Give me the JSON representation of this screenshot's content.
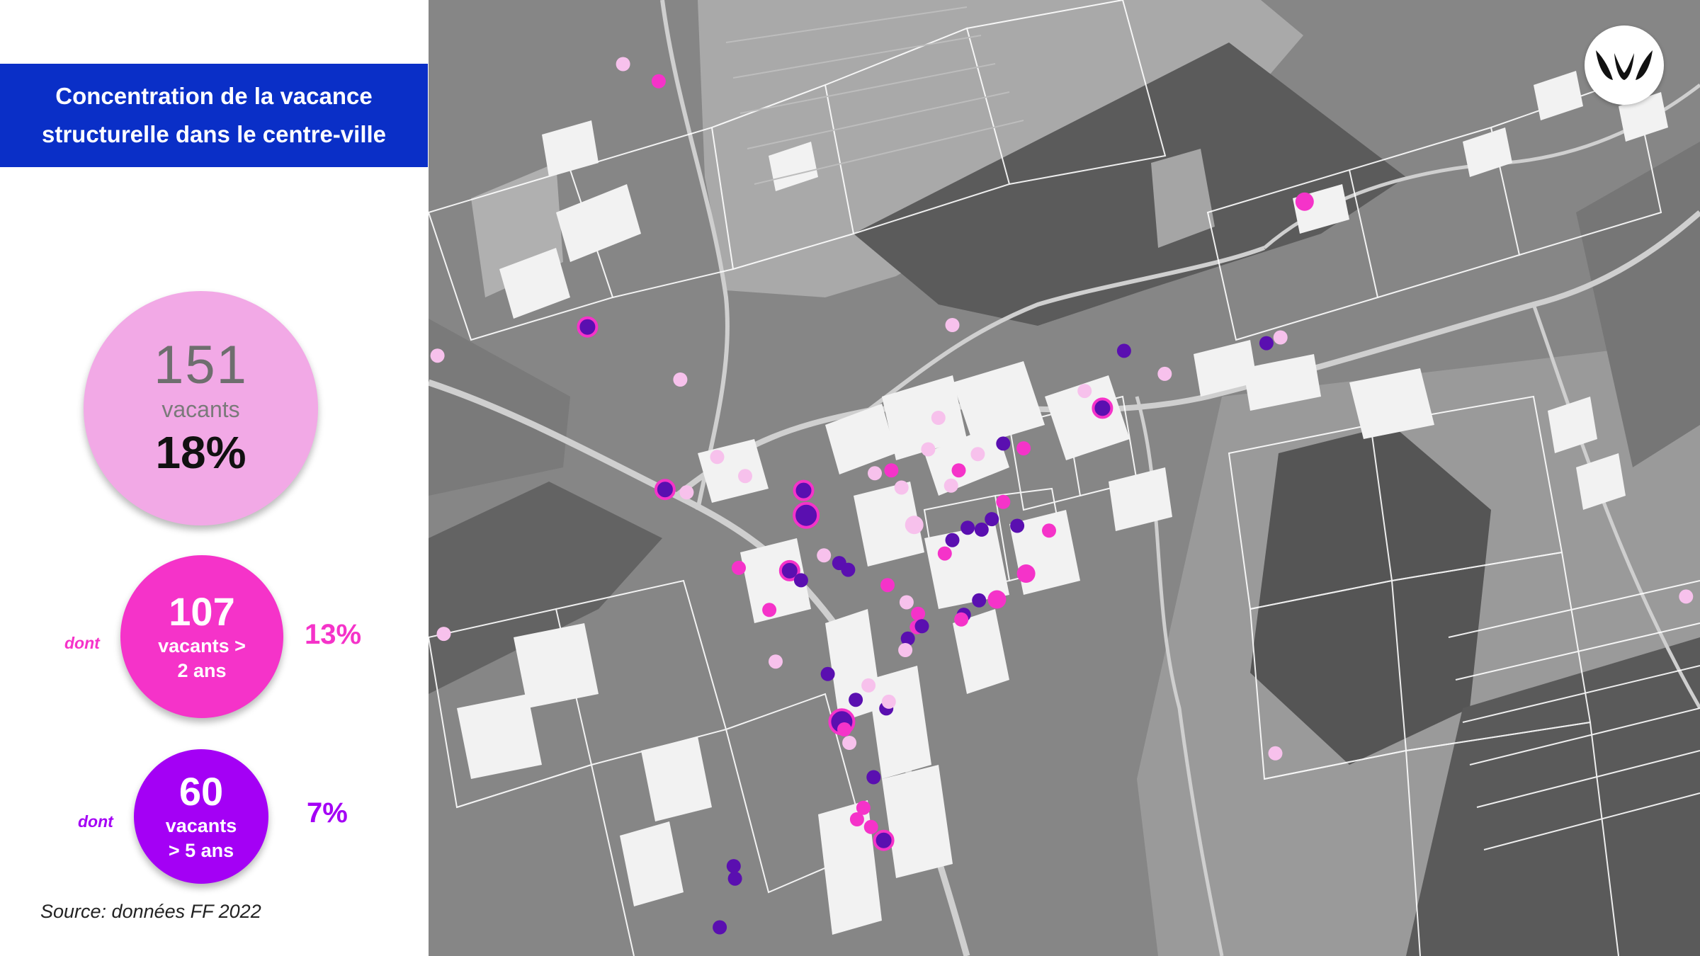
{
  "title": {
    "line1": "Concentration de la vacance",
    "line2": "structurelle dans le centre-ville"
  },
  "stats": {
    "total": {
      "count": "151",
      "label": "vacants",
      "percent": "18%",
      "color": "#f2a9e6"
    },
    "over_2_years": {
      "prefix": "dont",
      "count": "107",
      "label_line1": "vacants >",
      "label_line2": "2 ans",
      "percent": "13%",
      "color": "#f533c9"
    },
    "over_5_years": {
      "prefix": "dont",
      "count": "60",
      "label_line1": "vacants",
      "label_line2": "> 5 ans",
      "percent": "7%",
      "color": "#a400f5"
    }
  },
  "source": "Source: données FF 2022",
  "map": {
    "style": "grayscale aerial photo with white cadastral parcel outlines and highlighted buildings",
    "marker_colors": {
      "total": "#f7c1ec",
      "over_2_years": "#f533c9",
      "over_5_years": "#5a0fb0"
    },
    "markers": [
      {
        "x": 0.153,
        "y": 0.067,
        "cat": "total",
        "size": "s"
      },
      {
        "x": 0.181,
        "y": 0.085,
        "cat": "over_2_years",
        "size": "s"
      },
      {
        "x": 0.125,
        "y": 0.342,
        "cat": "over_5_years",
        "size": "m"
      },
      {
        "x": 0.007,
        "y": 0.372,
        "cat": "total",
        "size": "s"
      },
      {
        "x": 0.198,
        "y": 0.397,
        "cat": "total",
        "size": "s"
      },
      {
        "x": 0.227,
        "y": 0.478,
        "cat": "total",
        "size": "s"
      },
      {
        "x": 0.186,
        "y": 0.512,
        "cat": "over_5_years",
        "size": "m"
      },
      {
        "x": 0.203,
        "y": 0.515,
        "cat": "total",
        "size": "s"
      },
      {
        "x": 0.295,
        "y": 0.513,
        "cat": "over_5_years",
        "size": "m"
      },
      {
        "x": 0.297,
        "y": 0.539,
        "cat": "over_5_years",
        "size": "l"
      },
      {
        "x": 0.244,
        "y": 0.594,
        "cat": "over_2_years",
        "size": "s"
      },
      {
        "x": 0.284,
        "y": 0.597,
        "cat": "over_5_years",
        "size": "m"
      },
      {
        "x": 0.293,
        "y": 0.607,
        "cat": "over_5_years",
        "size": "s"
      },
      {
        "x": 0.311,
        "y": 0.581,
        "cat": "total",
        "size": "s"
      },
      {
        "x": 0.323,
        "y": 0.589,
        "cat": "over_5_years",
        "size": "s"
      },
      {
        "x": 0.33,
        "y": 0.596,
        "cat": "over_5_years",
        "size": "s"
      },
      {
        "x": 0.351,
        "y": 0.495,
        "cat": "total",
        "size": "s"
      },
      {
        "x": 0.364,
        "y": 0.492,
        "cat": "over_2_years",
        "size": "s"
      },
      {
        "x": 0.361,
        "y": 0.612,
        "cat": "over_2_years",
        "size": "s"
      },
      {
        "x": 0.382,
        "y": 0.549,
        "cat": "total",
        "size": "m"
      },
      {
        "x": 0.372,
        "y": 0.51,
        "cat": "total",
        "size": "s"
      },
      {
        "x": 0.393,
        "y": 0.47,
        "cat": "total",
        "size": "s"
      },
      {
        "x": 0.417,
        "y": 0.492,
        "cat": "over_2_years",
        "size": "s"
      },
      {
        "x": 0.411,
        "y": 0.508,
        "cat": "total",
        "size": "s"
      },
      {
        "x": 0.401,
        "y": 0.437,
        "cat": "total",
        "size": "s"
      },
      {
        "x": 0.406,
        "y": 0.579,
        "cat": "over_2_years",
        "size": "s"
      },
      {
        "x": 0.412,
        "y": 0.565,
        "cat": "over_5_years",
        "size": "s"
      },
      {
        "x": 0.424,
        "y": 0.552,
        "cat": "over_5_years",
        "size": "s"
      },
      {
        "x": 0.435,
        "y": 0.554,
        "cat": "over_5_years",
        "size": "s"
      },
      {
        "x": 0.443,
        "y": 0.543,
        "cat": "over_5_years",
        "size": "s"
      },
      {
        "x": 0.452,
        "y": 0.525,
        "cat": "over_2_years",
        "size": "s"
      },
      {
        "x": 0.463,
        "y": 0.55,
        "cat": "over_5_years",
        "size": "s"
      },
      {
        "x": 0.47,
        "y": 0.6,
        "cat": "over_2_years",
        "size": "m"
      },
      {
        "x": 0.452,
        "y": 0.464,
        "cat": "over_5_years",
        "size": "s"
      },
      {
        "x": 0.468,
        "y": 0.469,
        "cat": "over_2_years",
        "size": "s"
      },
      {
        "x": 0.432,
        "y": 0.475,
        "cat": "total",
        "size": "s"
      },
      {
        "x": 0.433,
        "y": 0.628,
        "cat": "over_5_years",
        "size": "s"
      },
      {
        "x": 0.421,
        "y": 0.643,
        "cat": "over_5_years",
        "size": "s"
      },
      {
        "x": 0.419,
        "y": 0.648,
        "cat": "over_2_years",
        "size": "s"
      },
      {
        "x": 0.447,
        "y": 0.627,
        "cat": "over_2_years",
        "size": "m"
      },
      {
        "x": 0.376,
        "y": 0.63,
        "cat": "total",
        "size": "s"
      },
      {
        "x": 0.385,
        "y": 0.642,
        "cat": "over_2_years",
        "size": "s"
      },
      {
        "x": 0.384,
        "y": 0.656,
        "cat": "over_2_years",
        "size": "s"
      },
      {
        "x": 0.388,
        "y": 0.655,
        "cat": "over_5_years",
        "size": "s"
      },
      {
        "x": 0.377,
        "y": 0.668,
        "cat": "over_5_years",
        "size": "s"
      },
      {
        "x": 0.375,
        "y": 0.68,
        "cat": "total",
        "size": "s"
      },
      {
        "x": 0.268,
        "y": 0.638,
        "cat": "over_2_years",
        "size": "s"
      },
      {
        "x": 0.273,
        "y": 0.692,
        "cat": "total",
        "size": "s"
      },
      {
        "x": 0.314,
        "y": 0.705,
        "cat": "over_5_years",
        "size": "s"
      },
      {
        "x": 0.336,
        "y": 0.732,
        "cat": "over_5_years",
        "size": "s"
      },
      {
        "x": 0.346,
        "y": 0.717,
        "cat": "total",
        "size": "s"
      },
      {
        "x": 0.36,
        "y": 0.741,
        "cat": "over_5_years",
        "size": "s"
      },
      {
        "x": 0.362,
        "y": 0.734,
        "cat": "total",
        "size": "s"
      },
      {
        "x": 0.331,
        "y": 0.777,
        "cat": "total",
        "size": "s"
      },
      {
        "x": 0.325,
        "y": 0.755,
        "cat": "over_5_years",
        "size": "l"
      },
      {
        "x": 0.327,
        "y": 0.763,
        "cat": "over_2_years",
        "size": "s"
      },
      {
        "x": 0.35,
        "y": 0.813,
        "cat": "over_5_years",
        "size": "s"
      },
      {
        "x": 0.342,
        "y": 0.845,
        "cat": "over_2_years",
        "size": "s"
      },
      {
        "x": 0.337,
        "y": 0.857,
        "cat": "over_2_years",
        "size": "s"
      },
      {
        "x": 0.348,
        "y": 0.865,
        "cat": "over_2_years",
        "size": "s"
      },
      {
        "x": 0.358,
        "y": 0.879,
        "cat": "over_5_years",
        "size": "m"
      },
      {
        "x": 0.24,
        "y": 0.906,
        "cat": "over_5_years",
        "size": "s"
      },
      {
        "x": 0.241,
        "y": 0.919,
        "cat": "over_5_years",
        "size": "s"
      },
      {
        "x": 0.229,
        "y": 0.97,
        "cat": "over_5_years",
        "size": "s"
      },
      {
        "x": 0.012,
        "y": 0.663,
        "cat": "total",
        "size": "s"
      },
      {
        "x": 0.249,
        "y": 0.498,
        "cat": "total",
        "size": "s"
      },
      {
        "x": 0.412,
        "y": 0.34,
        "cat": "total",
        "size": "s"
      },
      {
        "x": 0.53,
        "y": 0.427,
        "cat": "over_5_years",
        "size": "m"
      },
      {
        "x": 0.516,
        "y": 0.409,
        "cat": "total",
        "size": "s"
      },
      {
        "x": 0.547,
        "y": 0.367,
        "cat": "over_5_years",
        "size": "s"
      },
      {
        "x": 0.579,
        "y": 0.391,
        "cat": "total",
        "size": "s"
      },
      {
        "x": 0.488,
        "y": 0.555,
        "cat": "over_2_years",
        "size": "s"
      },
      {
        "x": 0.659,
        "y": 0.359,
        "cat": "over_5_years",
        "size": "s"
      },
      {
        "x": 0.67,
        "y": 0.353,
        "cat": "total",
        "size": "s"
      },
      {
        "x": 0.689,
        "y": 0.211,
        "cat": "over_2_years",
        "size": "m"
      },
      {
        "x": 0.989,
        "y": 0.624,
        "cat": "total",
        "size": "s"
      },
      {
        "x": 0.666,
        "y": 0.788,
        "cat": "total",
        "size": "s"
      }
    ]
  }
}
